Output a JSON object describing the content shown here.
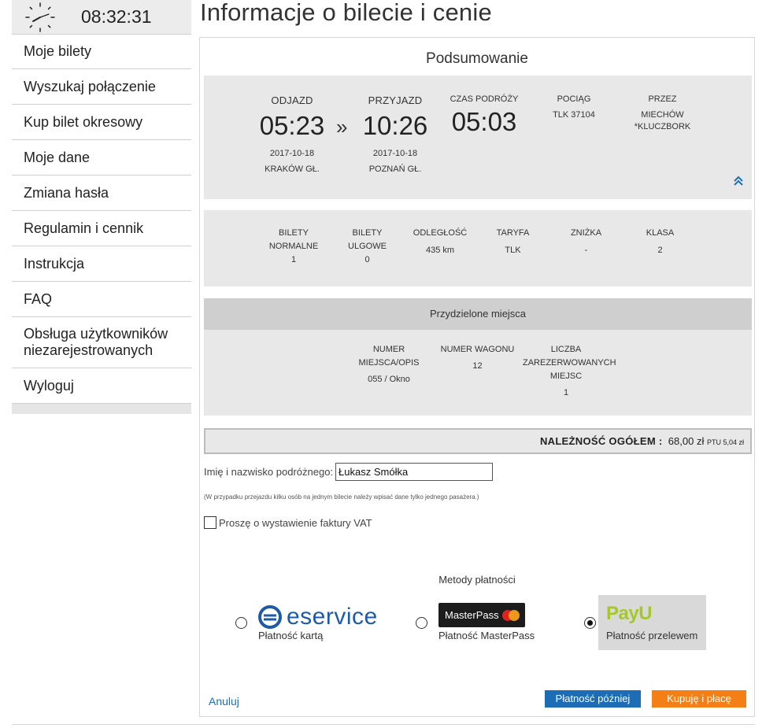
{
  "clock": {
    "time": "08:32:31"
  },
  "sidebar": {
    "items": [
      {
        "label": "Moje bilety"
      },
      {
        "label": "Wyszukaj połączenie"
      },
      {
        "label": "Kup bilet okresowy"
      },
      {
        "label": "Moje dane"
      },
      {
        "label": "Zmiana hasła"
      },
      {
        "label": "Regulamin i cennik"
      },
      {
        "label": "Instrukcja"
      },
      {
        "label": "FAQ"
      },
      {
        "label": "Obsługa użytkowników niezarejestrowanych"
      },
      {
        "label": "Wyloguj"
      }
    ]
  },
  "page": {
    "title": "Informacje o bilecie i cenie"
  },
  "summary": {
    "title": "Podsumowanie",
    "departure": {
      "label": "ODJAZD",
      "time": "05:23",
      "date": "2017-10-18",
      "station": "KRAKÓW GŁ."
    },
    "arrow": "»",
    "arrival": {
      "label": "PRZYJAZD",
      "time": "10:26",
      "date": "2017-10-18",
      "station": "POZNAŃ GŁ."
    },
    "duration": {
      "label": "CZAS PODRÓŻY",
      "value": "05:03"
    },
    "train": {
      "label": "POCIĄG",
      "value": "TLK 37104"
    },
    "via": {
      "label": "PRZEZ",
      "value1": "MIECHÓW",
      "value2": "*KLUCZBORK"
    }
  },
  "tickets": {
    "normal": {
      "label1": "BILETY",
      "label2": "NORMALNE",
      "value": "1"
    },
    "reduced": {
      "label1": "BILETY",
      "label2": "ULGOWE",
      "value": "0"
    },
    "distance": {
      "label": "ODLEGŁOŚĆ",
      "value": "435 km"
    },
    "tariff": {
      "label": "TARYFA",
      "value": "TLK"
    },
    "discount": {
      "label": "ZNIŻKA",
      "value": "-"
    },
    "class": {
      "label": "KLASA",
      "value": "2"
    }
  },
  "seats": {
    "title": "Przydzielone miejsca",
    "seat": {
      "label1": "NUMER",
      "label2": "MIEJSCA/OPIS",
      "value": "055 / Okno"
    },
    "car": {
      "label": "NUMER WAGONU",
      "value": "12"
    },
    "count": {
      "label1": "LICZBA",
      "label2": "ZAREZERWOWANYCH",
      "label3": "MIEJSC",
      "value": "1"
    }
  },
  "total": {
    "label": "NALEŻNOŚĆ OGÓŁEM :",
    "amount": "68,00 zł",
    "ptu": "PTU 5,04 zł"
  },
  "passenger": {
    "label": "Imię i nazwisko podróżnego:",
    "value": "Łukasz Smółka",
    "note": "(W przypadku przejazdu kilku osób na jednym bilecie należy wpisać dane tylko jednego pasażera.)",
    "vat_label": "Proszę o wystawienie faktury VAT",
    "vat_checked": false
  },
  "payment": {
    "title": "Metody płatności",
    "options": [
      {
        "logo": "eservice",
        "label": "Płatność kartą",
        "selected": false
      },
      {
        "logo": "MasterPass",
        "label": "Płatność MasterPass",
        "selected": false
      },
      {
        "logo": "PayU",
        "label": "Płatność przelewem",
        "selected": true
      }
    ]
  },
  "actions": {
    "cancel": "Anuluj",
    "pay_later": "Płatność później",
    "buy": "Kupuję i płacę"
  },
  "colors": {
    "accent_blue": "#1c6db5",
    "accent_orange": "#f57f17",
    "payu_green": "#a5c72c",
    "eservice_blue": "#1f5aa8"
  }
}
